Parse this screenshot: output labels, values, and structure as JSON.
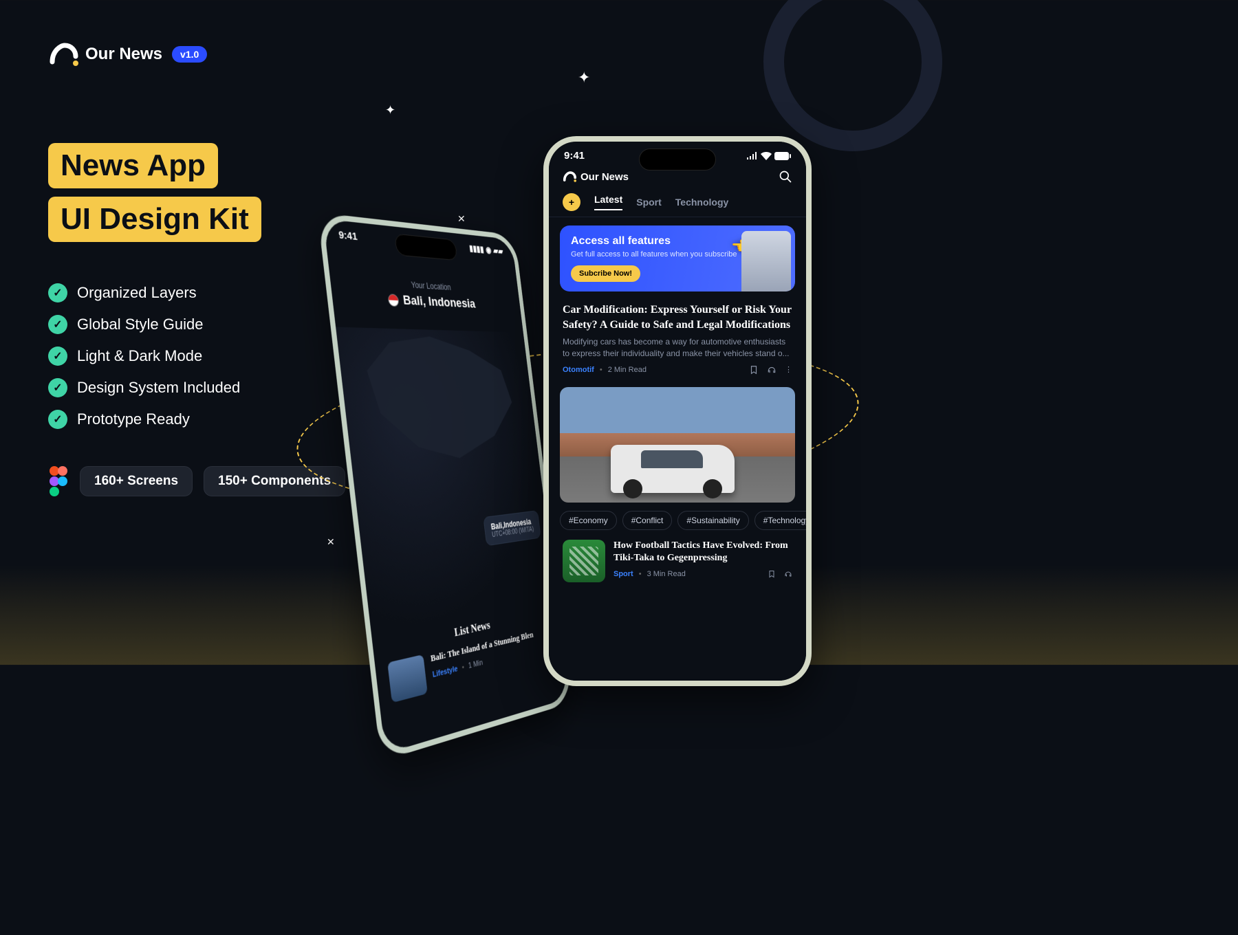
{
  "brand": {
    "name": "Our News",
    "version": "v1.0"
  },
  "headline": {
    "line1": "News App",
    "line2": "UI Design Kit"
  },
  "features": [
    "Organized Layers",
    "Global Style Guide",
    "Light & Dark Mode",
    "Design System Included",
    "Prototype Ready"
  ],
  "stats": {
    "screens": "160+ Screens",
    "components": "150+ Components"
  },
  "phone_right": {
    "time": "9:41",
    "app_title": "Our News",
    "tabs": [
      "Latest",
      "Sport",
      "Technology"
    ],
    "promo": {
      "title": "Access all features",
      "subtitle": "Get full access to all features when you subscribe",
      "cta": "Subcribe Now!"
    },
    "article1": {
      "title": "Car Modification: Express Yourself or Risk Your Safety? A Guide to Safe and Legal Modifications",
      "excerpt": "Modifying cars has become a way for automotive enthusiasts to express their individuality and make their vehicles stand o...",
      "category": "Otomotif",
      "read": "2 Min Read"
    },
    "hashtags": [
      "#Economy",
      "#Conflict",
      "#Sustainability",
      "#Technology"
    ],
    "article2": {
      "title": "How Football Tactics Have Evolved: From Tiki-Taka to Gegenpressing",
      "category": "Sport",
      "read": "3 Min Read"
    }
  },
  "phone_left": {
    "time": "9:41",
    "loc_label": "Your Location",
    "city": "Bali, Indonesia",
    "pin": {
      "city": "Bali,Indonesia",
      "tz": "UTC+08:00 (WITA)"
    },
    "list_heading": "List News",
    "story": {
      "title": "Bali: The Island of a Stunning Blen",
      "category": "Lifestyle",
      "read": "1 Min"
    }
  }
}
